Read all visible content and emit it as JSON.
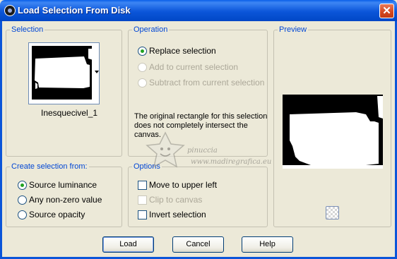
{
  "window": {
    "title": "Load Selection From Disk",
    "close_glyph": "✕"
  },
  "selection_group": {
    "title": "Selection",
    "thumbnail_caption": "Inesquecivel_1"
  },
  "operation_group": {
    "title": "Operation",
    "options": [
      {
        "label": "Replace selection",
        "checked": true,
        "disabled": false
      },
      {
        "label": "Add to current selection",
        "checked": false,
        "disabled": true
      },
      {
        "label": "Subtract from current selection",
        "checked": false,
        "disabled": true
      }
    ],
    "message_line1": "The original rectangle for this selection",
    "message_line2": "does not completely intersect the",
    "message_line3": "canvas."
  },
  "preview_group": {
    "title": "Preview"
  },
  "create_group": {
    "title": "Create selection from:",
    "options": [
      {
        "label": "Source luminance",
        "checked": true
      },
      {
        "label": "Any non-zero value",
        "checked": false
      },
      {
        "label": "Source opacity",
        "checked": false
      }
    ]
  },
  "options_group": {
    "title": "Options",
    "items": [
      {
        "label": "Move to upper left",
        "checked": false,
        "disabled": false
      },
      {
        "label": "Clip to canvas",
        "checked": false,
        "disabled": true
      },
      {
        "label": "Invert selection",
        "checked": false,
        "disabled": false
      }
    ]
  },
  "watermark": {
    "line1": "pinuccia",
    "line2": "www.madiregrafica.eu"
  },
  "buttons": {
    "load": "Load",
    "cancel": "Cancel",
    "help": "Help"
  },
  "colors": {
    "title_bar": "#0b55d9",
    "group_title": "#0046d5",
    "dialog_bg": "#ece9d8",
    "radio_dot": "#21a121",
    "close_button": "#d2461f"
  },
  "icons": [
    "app-icon",
    "close-icon",
    "dropdown-arrow-icon",
    "preview-toggle-icon",
    "watermark-logo-icon"
  ]
}
